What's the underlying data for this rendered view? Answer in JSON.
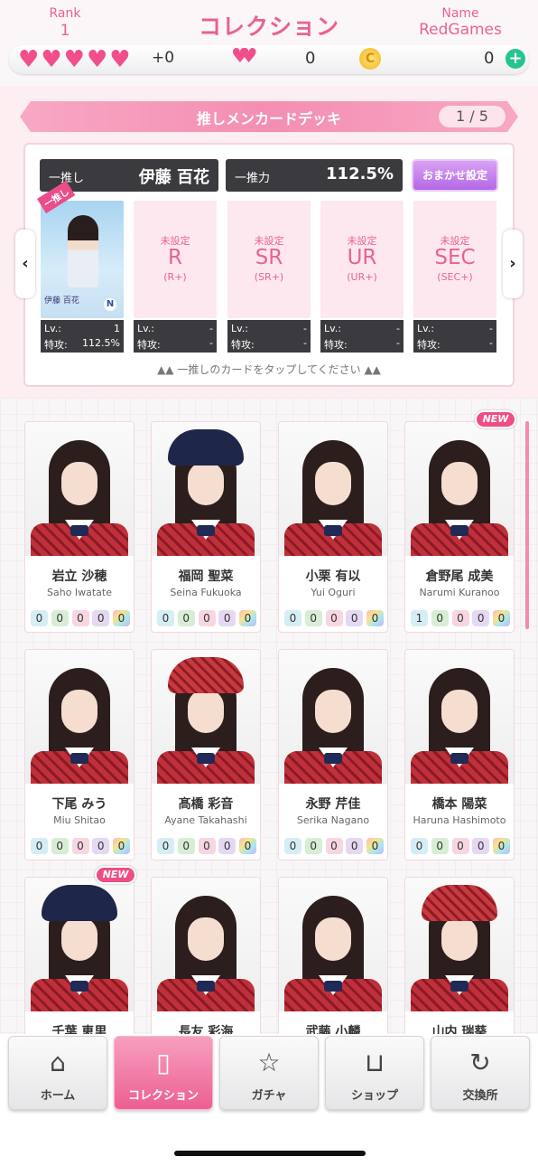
{
  "header": {
    "rank_label": "Rank",
    "rank_value": "1",
    "title": "コレクション",
    "name_label": "Name",
    "name_value": "RedGames"
  },
  "status": {
    "hearts": [
      "♥",
      "♥",
      "♥",
      "♥",
      "♥"
    ],
    "hearts_plus": "+0",
    "bonus_hearts": "♥♥",
    "bonus_count": "0",
    "coin_icon": "C",
    "coin_count": "0",
    "add_icon": "+"
  },
  "deck": {
    "title": "推しメンカードデッキ",
    "page": "1 / 5",
    "oshi_label": "一推し",
    "oshi_name": "伊藤 百花",
    "power_label": "一推力",
    "power_value": "112.5%",
    "auto_button": "おまかせ設定",
    "main_card": {
      "tag": "一推し",
      "name": "伊藤 百花",
      "rarity_badge": "N",
      "lv_label": "Lv.:",
      "lv_value": "1",
      "atk_label": "特攻:",
      "atk_value": "112.5%"
    },
    "slots": [
      {
        "status": "未設定",
        "rarity": "R",
        "sub": "(R+)",
        "lv_label": "Lv.:",
        "lv_value": "-",
        "atk_label": "特攻:",
        "atk_value": "-"
      },
      {
        "status": "未設定",
        "rarity": "SR",
        "sub": "(SR+)",
        "lv_label": "Lv.:",
        "lv_value": "-",
        "atk_label": "特攻:",
        "atk_value": "-"
      },
      {
        "status": "未設定",
        "rarity": "UR",
        "sub": "(UR+)",
        "lv_label": "Lv.:",
        "lv_value": "-",
        "atk_label": "特攻:",
        "atk_value": "-"
      },
      {
        "status": "未設定",
        "rarity": "SEC",
        "sub": "(SEC+)",
        "lv_label": "Lv.:",
        "lv_value": "-",
        "atk_label": "特攻:",
        "atk_value": "-"
      }
    ],
    "prev_arrow": "‹",
    "next_arrow": "›",
    "hint": "▲▲ 一推しのカードをタップしてください ▲▲"
  },
  "members": [
    {
      "name": "岩立 沙穂",
      "romaji": "Saho Iwatate",
      "counts": [
        "0",
        "0",
        "0",
        "0",
        "0"
      ],
      "new": ""
    },
    {
      "name": "福岡 聖菜",
      "romaji": "Seina Fukuoka",
      "counts": [
        "0",
        "0",
        "0",
        "0",
        "0"
      ],
      "new": ""
    },
    {
      "name": "小栗 有以",
      "romaji": "Yui Oguri",
      "counts": [
        "0",
        "0",
        "0",
        "0",
        "0"
      ],
      "new": ""
    },
    {
      "name": "倉野尾 成美",
      "romaji": "Narumi Kuranoo",
      "counts": [
        "1",
        "0",
        "0",
        "0",
        "0"
      ],
      "new": "NEW"
    },
    {
      "name": "下尾 みう",
      "romaji": "Miu Shitao",
      "counts": [
        "0",
        "0",
        "0",
        "0",
        "0"
      ],
      "new": ""
    },
    {
      "name": "髙橋 彩音",
      "romaji": "Ayane Takahashi",
      "counts": [
        "0",
        "0",
        "0",
        "0",
        "0"
      ],
      "new": ""
    },
    {
      "name": "永野 芹佳",
      "romaji": "Serika Nagano",
      "counts": [
        "0",
        "0",
        "0",
        "0",
        "0"
      ],
      "new": ""
    },
    {
      "name": "橋本 陽菜",
      "romaji": "Haruna Hashimoto",
      "counts": [
        "0",
        "0",
        "0",
        "0",
        "0"
      ],
      "new": ""
    },
    {
      "name": "千葉 恵里",
      "romaji": "",
      "counts": [],
      "new": "NEW"
    },
    {
      "name": "長友 彩海",
      "romaji": "",
      "counts": [],
      "new": ""
    },
    {
      "name": "武藤 小麟",
      "romaji": "",
      "counts": [],
      "new": ""
    },
    {
      "name": "山内 瑞葵",
      "romaji": "",
      "counts": [],
      "new": ""
    }
  ],
  "tabs": [
    {
      "label": "ホーム",
      "icon": "home-icon"
    },
    {
      "label": "コレクション",
      "icon": "book-icon"
    },
    {
      "label": "ガチャ",
      "icon": "gacha-card-icon"
    },
    {
      "label": "ショップ",
      "icon": "cart-icon"
    },
    {
      "label": "交換所",
      "icon": "exchange-coin-icon"
    }
  ],
  "colors": {
    "accent": "#e9628f",
    "active_tab": "#ec5f92",
    "new_badge": "#ee4d86"
  }
}
